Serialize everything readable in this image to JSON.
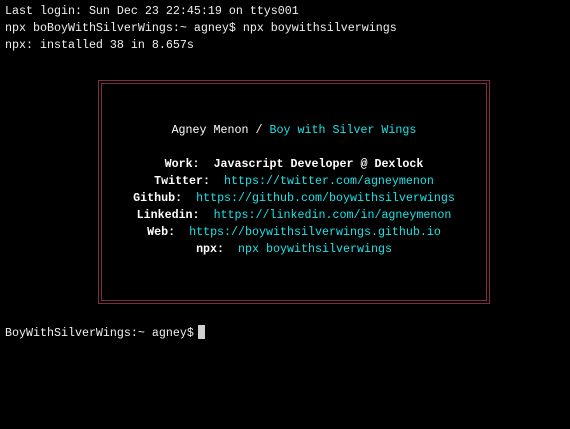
{
  "terminal": {
    "lines": [
      "Last login: Sun Dec 23 22:45:19 on ttys001",
      "npx boBoyWithSilverWings:~ agney$ npx boywithsilverwings",
      "npx: installed 38 in 8.657s"
    ],
    "prompt": "BoyWithSilverWings:~ agney$"
  },
  "card": {
    "name": "Agney Menon",
    "separator": " / ",
    "handle": "Boy with Silver Wings",
    "rows": [
      {
        "label": "Work:",
        "value": "Javascript Developer @ Dexlock",
        "value_color": "white"
      },
      {
        "label": "Twitter:",
        "value": "https://twitter.com/agneymenon"
      },
      {
        "label": "Github:",
        "value": "https://github.com/boywithsilverwings"
      },
      {
        "label": "Linkedin:",
        "value": "https://linkedin.com/in/agneymenon"
      },
      {
        "label": "Web:",
        "value": "https://boywithsilverwings.github.io"
      },
      {
        "label": "npx:",
        "value": "npx boywithsilverwings"
      }
    ]
  },
  "colors": {
    "border": "#7d2c48",
    "accent": "#19e3e8"
  }
}
